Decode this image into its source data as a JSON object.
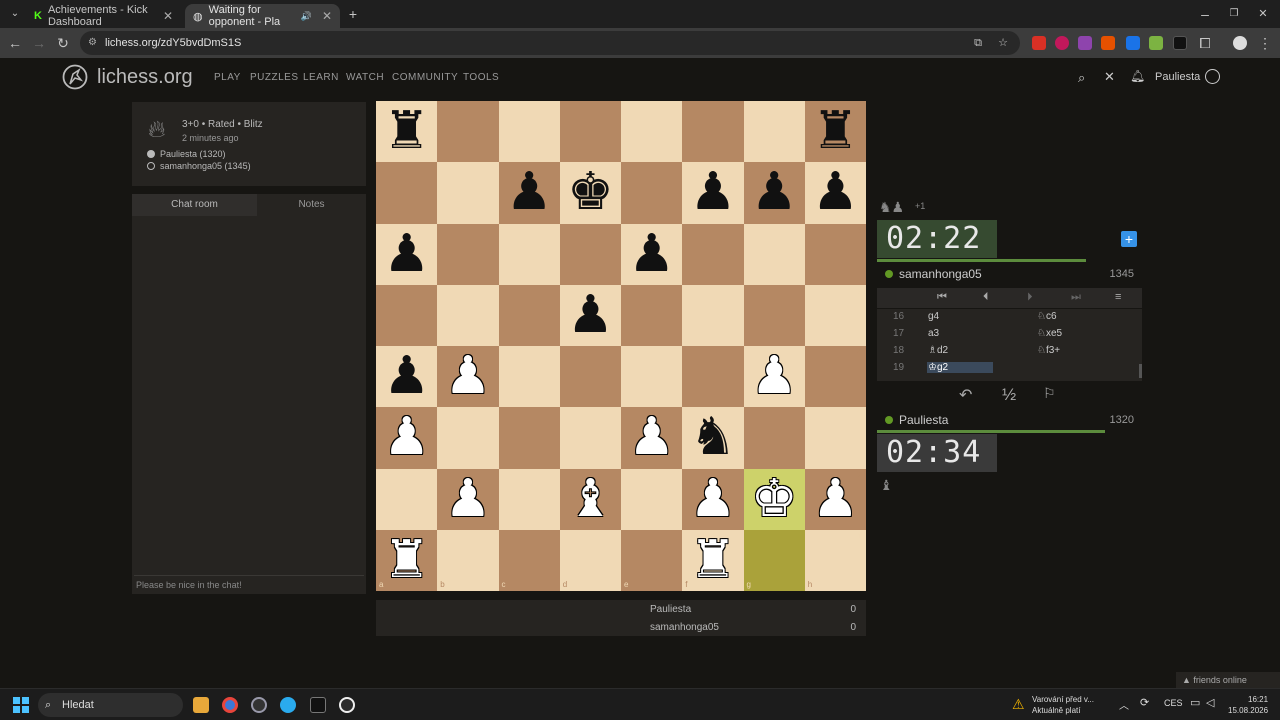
{
  "browser": {
    "tabs": [
      {
        "title": "Achievements - Kick Dashboard",
        "active": false
      },
      {
        "title": "Waiting for opponent - Pla",
        "active": true
      }
    ],
    "new_tab_label": "+",
    "url": "lichess.org/zdY5bvdDmS1S",
    "window_controls": [
      "–",
      "❐",
      "✕"
    ]
  },
  "site": {
    "logo_text": "lichess.org",
    "nav": [
      "PLAY",
      "PUZZLES",
      "LEARN",
      "WATCH",
      "COMMUNITY",
      "TOOLS"
    ],
    "username": "Pauliesta"
  },
  "game": {
    "meta": "3+0 • Rated • Blitz",
    "ago": "2 minutes ago",
    "white": "Pauliesta (1320)",
    "black": "samanhonga05 (1345)"
  },
  "chat": {
    "tab_chat": "Chat room",
    "tab_notes": "Notes",
    "placeholder": "Please be nice in the chat!"
  },
  "board": {
    "files": [
      "a",
      "b",
      "c",
      "d",
      "e",
      "f",
      "g",
      "h"
    ],
    "ranks": [
      "8",
      "7",
      "6",
      "5",
      "4",
      "3",
      "2",
      "1"
    ],
    "pieces": [
      {
        "sq": "a8",
        "p": "r"
      },
      {
        "sq": "h8",
        "p": "r"
      },
      {
        "sq": "c7",
        "p": "p"
      },
      {
        "sq": "d7",
        "p": "k"
      },
      {
        "sq": "f7",
        "p": "p"
      },
      {
        "sq": "g7",
        "p": "p"
      },
      {
        "sq": "h7",
        "p": "p"
      },
      {
        "sq": "a6",
        "p": "p"
      },
      {
        "sq": "e6",
        "p": "p"
      },
      {
        "sq": "d5",
        "p": "p"
      },
      {
        "sq": "a4",
        "p": "p"
      },
      {
        "sq": "b4",
        "p": "P"
      },
      {
        "sq": "g4",
        "p": "P"
      },
      {
        "sq": "a3",
        "p": "P"
      },
      {
        "sq": "e3",
        "p": "P"
      },
      {
        "sq": "f3",
        "p": "n"
      },
      {
        "sq": "b2",
        "p": "P"
      },
      {
        "sq": "d2",
        "p": "B"
      },
      {
        "sq": "f2",
        "p": "P"
      },
      {
        "sq": "g2",
        "p": "K"
      },
      {
        "sq": "h2",
        "p": "P"
      },
      {
        "sq": "a1",
        "p": "R"
      },
      {
        "sq": "f1",
        "p": "R"
      }
    ],
    "highlight": [
      "g2",
      "g1"
    ]
  },
  "right": {
    "material": "+1",
    "opponent_clock": "02:22",
    "opponent_name": "samanhonga05",
    "opponent_rating": "1345",
    "player_clock": "02:34",
    "player_name": "Pauliesta",
    "player_rating": "1320",
    "moves": [
      {
        "n": "16",
        "w": "g4",
        "b": "♘c6"
      },
      {
        "n": "17",
        "w": "a3",
        "b": "♘xe5"
      },
      {
        "n": "18",
        "w": "♗d2",
        "b": "♘f3+"
      },
      {
        "n": "19",
        "w": "♔g2",
        "b": ""
      }
    ],
    "draw_label": "½"
  },
  "score": [
    {
      "name": "Pauliesta",
      "value": "0"
    },
    {
      "name": "samanhonga05",
      "value": "0"
    }
  ],
  "friends_label": "▲ friends online",
  "taskbar": {
    "search": "Hledat",
    "notif_line1": "Varování před v...",
    "notif_line2": "Aktuálně platí",
    "lang": "CES",
    "time": "16:21",
    "date": "15.08.2026"
  }
}
